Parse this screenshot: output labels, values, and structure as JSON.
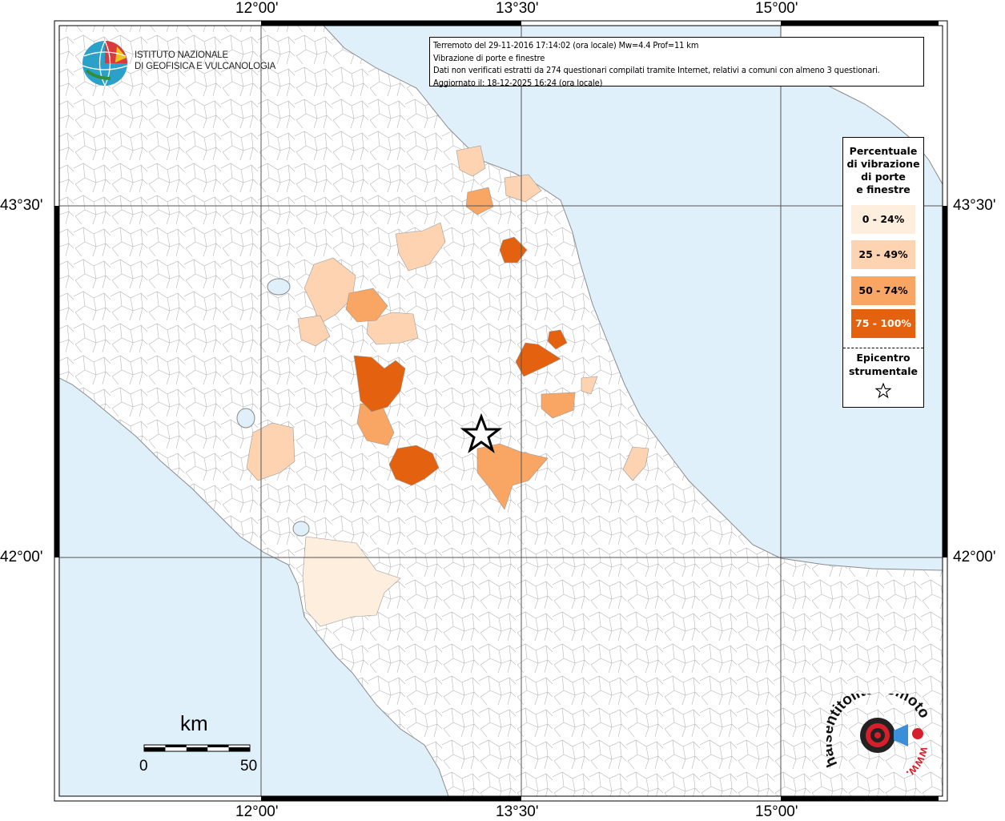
{
  "frame": {
    "lon_ticks": [
      {
        "label": "12°00'",
        "lon": 12.0
      },
      {
        "label": "13°30'",
        "lon": 13.5
      },
      {
        "label": "15°00'",
        "lon": 15.0
      }
    ],
    "lat_ticks": [
      {
        "label": "43°30'",
        "lat": 43.5
      },
      {
        "label": "42°00'",
        "lat": 42.0
      }
    ]
  },
  "info": {
    "line1": "Terremoto del 29-11-2016 17:14:02 (ora locale) Mw=4.4 Prof=11 km",
    "line2": "Vibrazione di porte e finestre",
    "line3": "Dati non verificati estratti da 274 questionari compilati tramite Internet, relativi a comuni con almeno 3 questionari.",
    "line4": "Aggiornato il: 18-12-2025 16:24 (ora locale)"
  },
  "legend": {
    "title_lines": [
      "Percentuale",
      "di vibrazione",
      "di porte",
      "e finestre"
    ],
    "classes": [
      {
        "label": "0 - 24%",
        "color": "#fdeedd",
        "text_color": "#000000"
      },
      {
        "label": "25 - 49%",
        "color": "#fdd3b2",
        "text_color": "#000000"
      },
      {
        "label": "50 - 74%",
        "color": "#f9a564",
        "text_color": "#000000"
      },
      {
        "label": "75 - 100%",
        "color": "#e4620f",
        "text_color": "#ffffff"
      }
    ],
    "epicenter_lines": [
      "Epicentro",
      "strumentale"
    ]
  },
  "logo": {
    "line1": "ISTITUTO NAZIONALE",
    "line2": "DI GEOFISICA E VULCANOLOGIA"
  },
  "scale": {
    "unit": "km",
    "start": "0",
    "end": "50"
  },
  "badge": {
    "text": "haisentitoilterremoto.it",
    "url_text": "www.",
    "badge_color": "#d81e2a"
  },
  "colors": {
    "sea": "#dff0fb",
    "land": "#ffffff",
    "border": "#9a9a9a"
  }
}
